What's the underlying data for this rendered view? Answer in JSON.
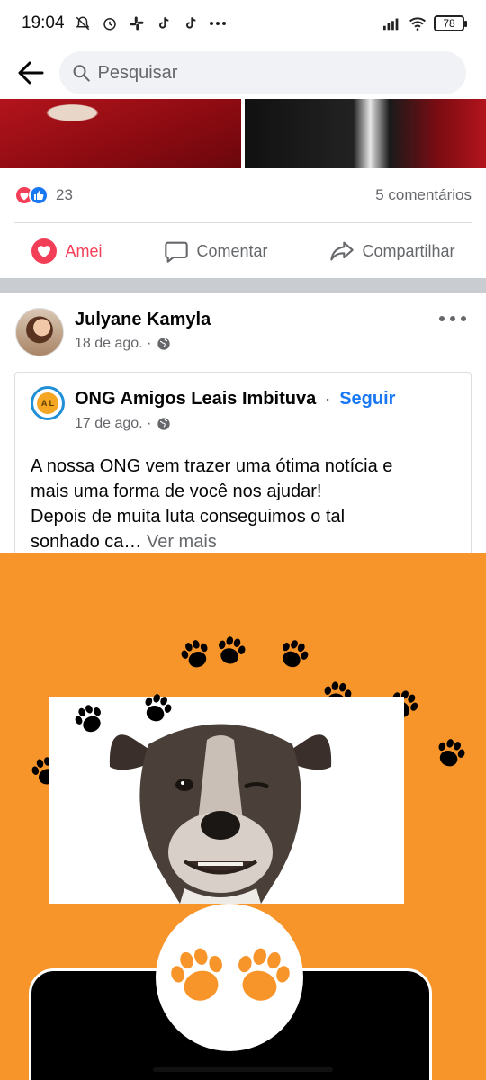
{
  "status_bar": {
    "time": "19:04",
    "battery": "78",
    "icons": [
      "muted-bell-icon",
      "alarm-icon",
      "slack-icon",
      "tiktok-icon",
      "tiktok-icon",
      "more-dots-icon",
      "signal-icon",
      "wifi-icon",
      "battery-icon"
    ]
  },
  "search": {
    "placeholder": "Pesquisar"
  },
  "previous_post": {
    "reaction_count": "23",
    "comments": "5 comentários",
    "actions": {
      "love": "Amei",
      "comment": "Comentar",
      "share": "Compartilhar"
    },
    "colors": {
      "love": "#f33e58",
      "like": "#1877f2"
    }
  },
  "post": {
    "author": "Julyane Kamyla",
    "date": "18 de ago. ·",
    "shared": {
      "org_name": "ONG Amigos Leais Imbituva",
      "separator": "·",
      "follow": "Seguir",
      "logo_text": "A L",
      "date": "17 de ago. ·",
      "text_lines": [
        "A nossa ONG vem trazer uma ótima notícia e",
        "mais uma forma de você nos ajudar!",
        "Depois de muita luta conseguimos o tal",
        "sonhado ca…"
      ],
      "see_more": "Ver mais"
    },
    "image": {
      "background": "#f8952a",
      "paw_color_dark": "#000000",
      "paw_color_orange": "#f8952a"
    }
  }
}
